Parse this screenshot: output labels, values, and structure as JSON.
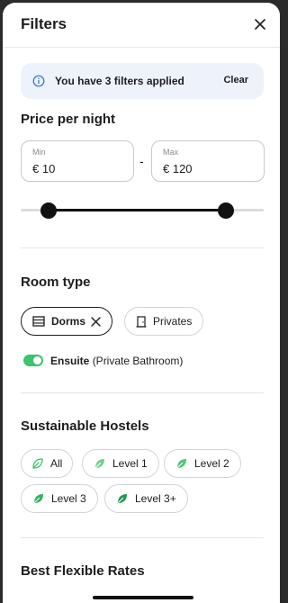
{
  "header": {
    "title": "Filters"
  },
  "banner": {
    "text": "You have 3 filters applied",
    "clear_label": "Clear"
  },
  "price": {
    "title": "Price per night",
    "min_label": "Min",
    "min_value": "€ 10",
    "max_label": "Max",
    "max_value": "€ 120",
    "separator": "-"
  },
  "room_type": {
    "title": "Room type",
    "options": [
      {
        "label": "Dorms",
        "selected": true
      },
      {
        "label": "Privates",
        "selected": false
      }
    ],
    "ensuite": {
      "label": "Ensuite",
      "detail": "(Private Bathroom)",
      "on": true
    }
  },
  "sustainable": {
    "title": "Sustainable Hostels",
    "options": [
      {
        "label": "All",
        "icon": "leaf-icon"
      },
      {
        "label": "Level 1",
        "icon": "leaf-icon"
      },
      {
        "label": "Level 2",
        "icon": "leaf-icon"
      },
      {
        "label": "Level 3",
        "icon": "leaf-icon"
      },
      {
        "label": "Level 3+",
        "icon": "leaf-icon"
      }
    ]
  },
  "flexible": {
    "title": "Best Flexible Rates"
  },
  "colors": {
    "accent_green": "#3cc46a",
    "banner_bg": "#eef3fb",
    "info_blue": "#2f6fd6"
  }
}
